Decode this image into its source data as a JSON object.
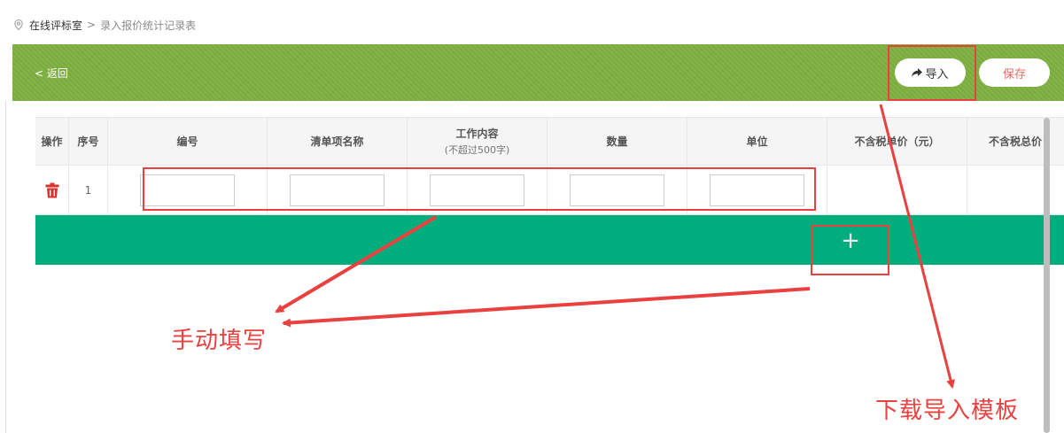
{
  "breadcrumb": {
    "home": "在线评标室",
    "separator": ">",
    "current": "录入报价统计记录表",
    "icon": "location-pin-icon"
  },
  "header": {
    "back_label": "< 返回",
    "import_label": "导入",
    "import_icon": "share-arrow-icon",
    "save_label": "保存",
    "bar_color": "#7fb040"
  },
  "table": {
    "columns": [
      {
        "label": "操作"
      },
      {
        "label": "序号"
      },
      {
        "label": "编号"
      },
      {
        "label": "清单项名称"
      },
      {
        "label": "工作内容",
        "sub": "(不超过500字)"
      },
      {
        "label": "数量"
      },
      {
        "label": "单位"
      },
      {
        "label": "不含税单价（元）"
      },
      {
        "label": "不含税总价"
      }
    ],
    "rows": [
      {
        "index": "1",
        "inputs": [
          "",
          "",
          "",
          "",
          ""
        ]
      }
    ],
    "add_label": "+",
    "add_bar_color": "#00ad7c"
  },
  "annotations": {
    "manual_fill": "手动填写",
    "download_template": "下载导入模板",
    "color": "#e8413f"
  }
}
